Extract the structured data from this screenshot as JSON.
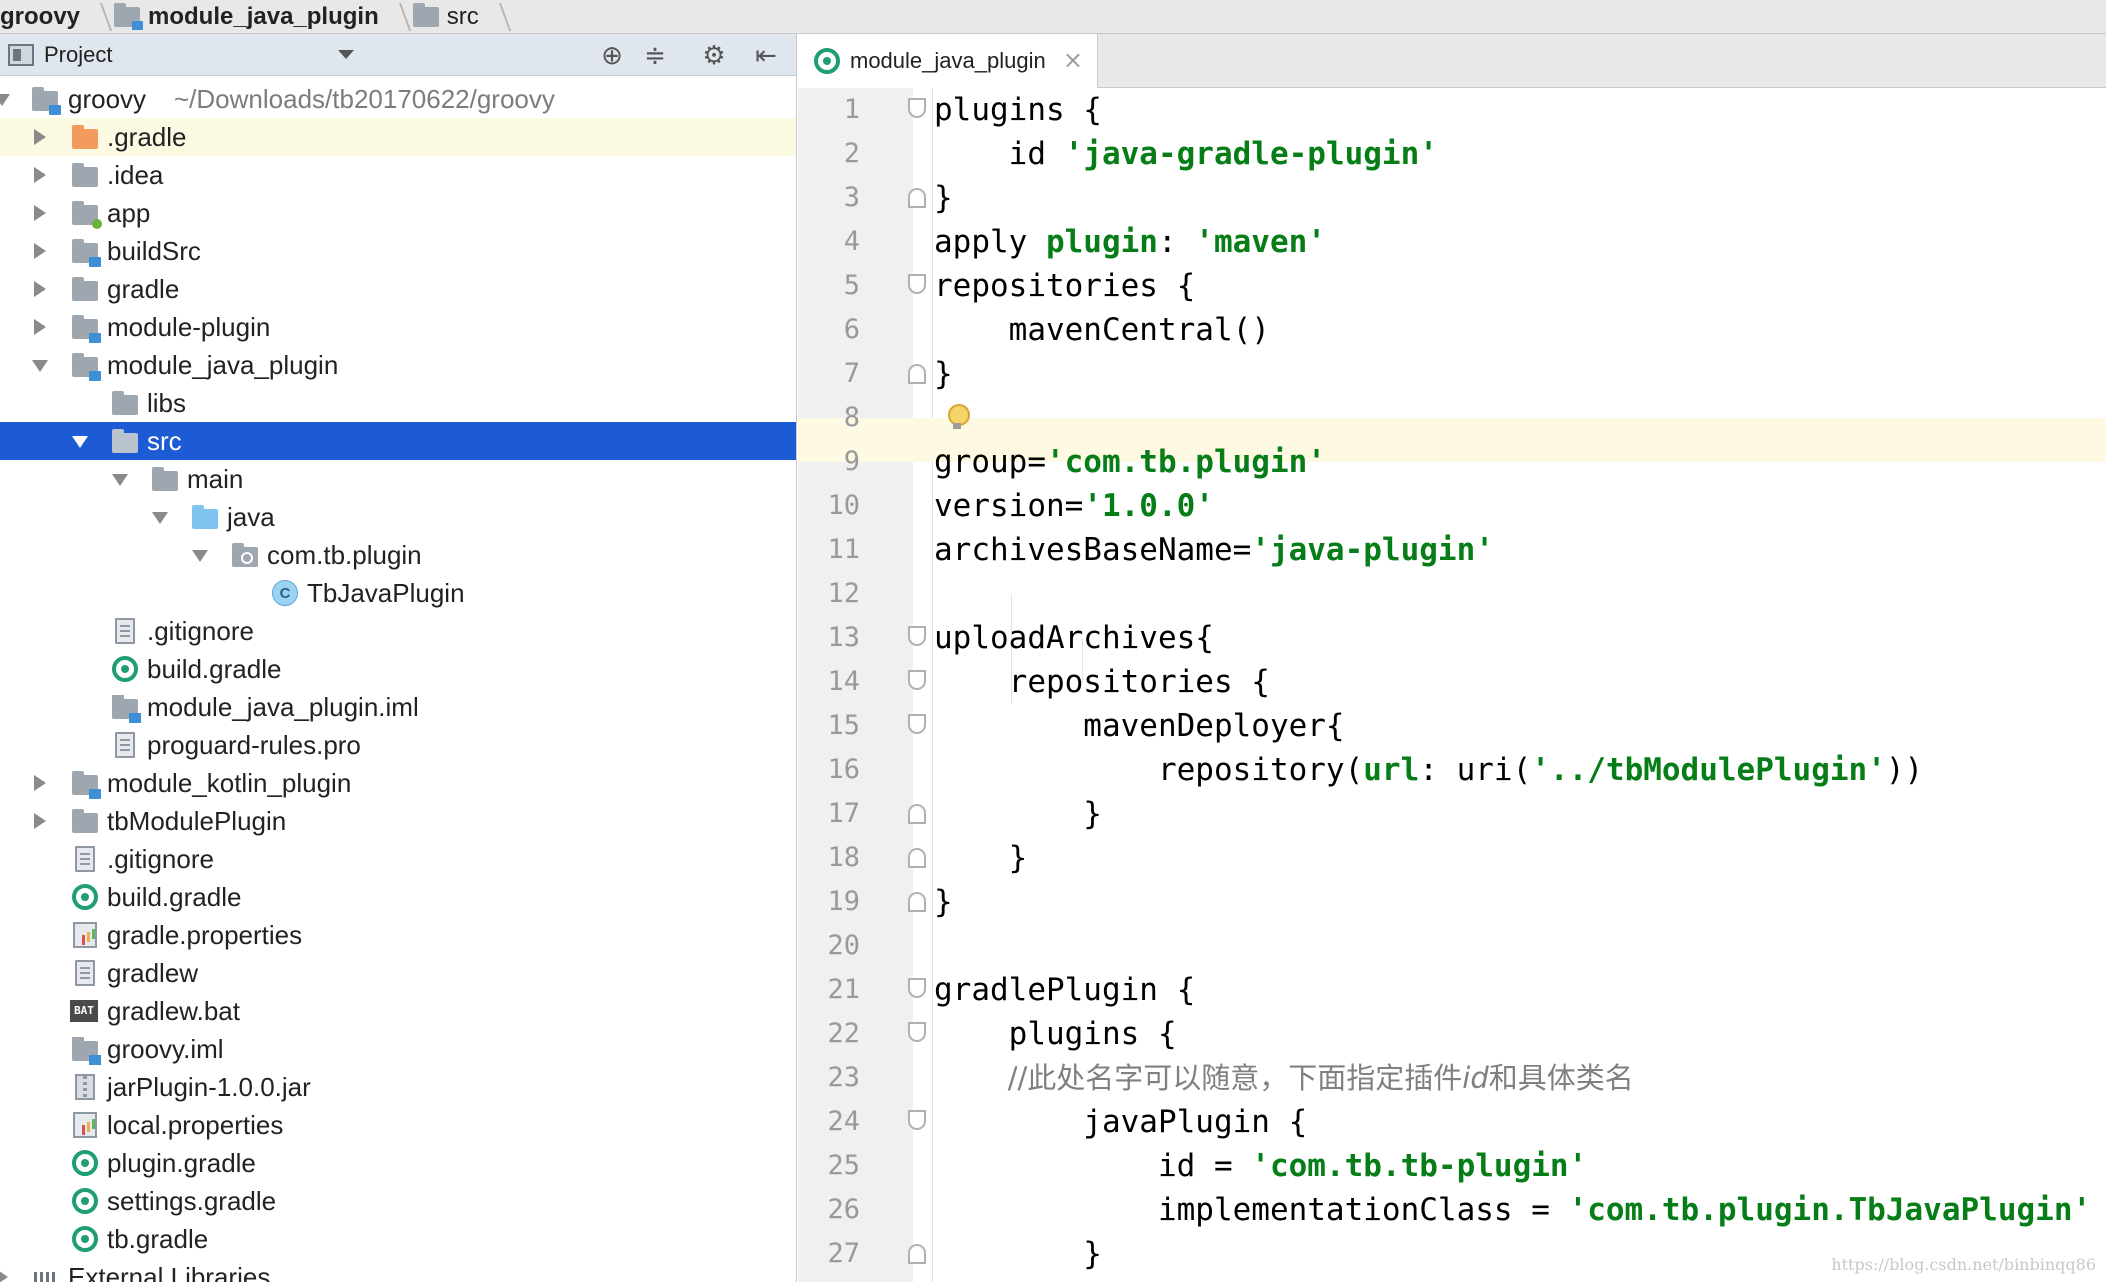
{
  "breadcrumb": {
    "items": [
      "groovy",
      "module_java_plugin",
      "src"
    ]
  },
  "project_panel": {
    "title": "Project",
    "icons": [
      "locate-icon",
      "collapse-all-icon",
      "settings-icon",
      "hide-icon"
    ]
  },
  "tree": {
    "root_name": "groovy",
    "root_path": "~/Downloads/tb20170622/groovy",
    "items": [
      {
        "label": ".gradle"
      },
      {
        "label": ".idea"
      },
      {
        "label": "app"
      },
      {
        "label": "buildSrc"
      },
      {
        "label": "gradle"
      },
      {
        "label": "module-plugin"
      },
      {
        "label": "module_java_plugin"
      },
      {
        "label": "libs"
      },
      {
        "label": "src"
      },
      {
        "label": "main"
      },
      {
        "label": "java"
      },
      {
        "label": "com.tb.plugin"
      },
      {
        "label": "TbJavaPlugin"
      },
      {
        "label": ".gitignore"
      },
      {
        "label": "build.gradle"
      },
      {
        "label": "module_java_plugin.iml"
      },
      {
        "label": "proguard-rules.pro"
      },
      {
        "label": "module_kotlin_plugin"
      },
      {
        "label": "tbModulePlugin"
      },
      {
        "label": ".gitignore"
      },
      {
        "label": "build.gradle"
      },
      {
        "label": "gradle.properties"
      },
      {
        "label": "gradlew"
      },
      {
        "label": "gradlew.bat"
      },
      {
        "label": "groovy.iml"
      },
      {
        "label": "jarPlugin-1.0.0.jar"
      },
      {
        "label": "local.properties"
      },
      {
        "label": "plugin.gradle"
      },
      {
        "label": "settings.gradle"
      },
      {
        "label": "tb.gradle"
      },
      {
        "label": "External Libraries"
      }
    ]
  },
  "editor": {
    "tab_label": "module_java_plugin",
    "bat_icon_text": "BAT",
    "class_icon_text": "C",
    "line_numbers": [
      "1",
      "2",
      "3",
      "4",
      "5",
      "6",
      "7",
      "8",
      "9",
      "10",
      "11",
      "12",
      "13",
      "14",
      "15",
      "16",
      "17",
      "18",
      "19",
      "20",
      "21",
      "22",
      "23",
      "24",
      "25",
      "26",
      "27"
    ],
    "code": {
      "l1": "plugins {",
      "l2a": "    id ",
      "l2b": "'java-gradle-plugin'",
      "l3": "}",
      "l4a": "apply ",
      "l4b": "plugin",
      "l4c": ": ",
      "l4d": "'maven'",
      "l5": "repositories {",
      "l6": "    mavenCentral()",
      "l7": "}",
      "l9a": "group=",
      "l9b": "'com.tb.plugin'",
      "l10a": "version=",
      "l10b": "'1.0.0'",
      "l11a": "archivesBaseName=",
      "l11b": "'java-plugin'",
      "l13": "uploadArchives{",
      "l14": "    repositories {",
      "l15": "        mavenDeployer{",
      "l16a": "            repository(",
      "l16b": "url",
      "l16c": ": uri(",
      "l16d": "'../tbModulePlugin'",
      "l16e": "))",
      "l17": "        }",
      "l18": "    }",
      "l19": "}",
      "l21": "gradlePlugin {",
      "l22": "    plugins {",
      "l23a": "        //此处名字可以随意，下面指定插件",
      "l23b": "id",
      "l23c": "和具体类名",
      "l24": "        javaPlugin {",
      "l25a": "            id = ",
      "l25b": "'com.tb.tb-plugin'",
      "l26a": "            implementationClass = ",
      "l26b": "'com.tb.plugin.TbJavaPlugin'",
      "l27": "        }"
    }
  },
  "watermark": "https://blog.csdn.net/binbinqq86",
  "colors": {
    "selection": "#1c5bd4",
    "string_green": "#067d17",
    "current_line": "#fdf9e2",
    "gradle_icon": "#1f9e74"
  }
}
